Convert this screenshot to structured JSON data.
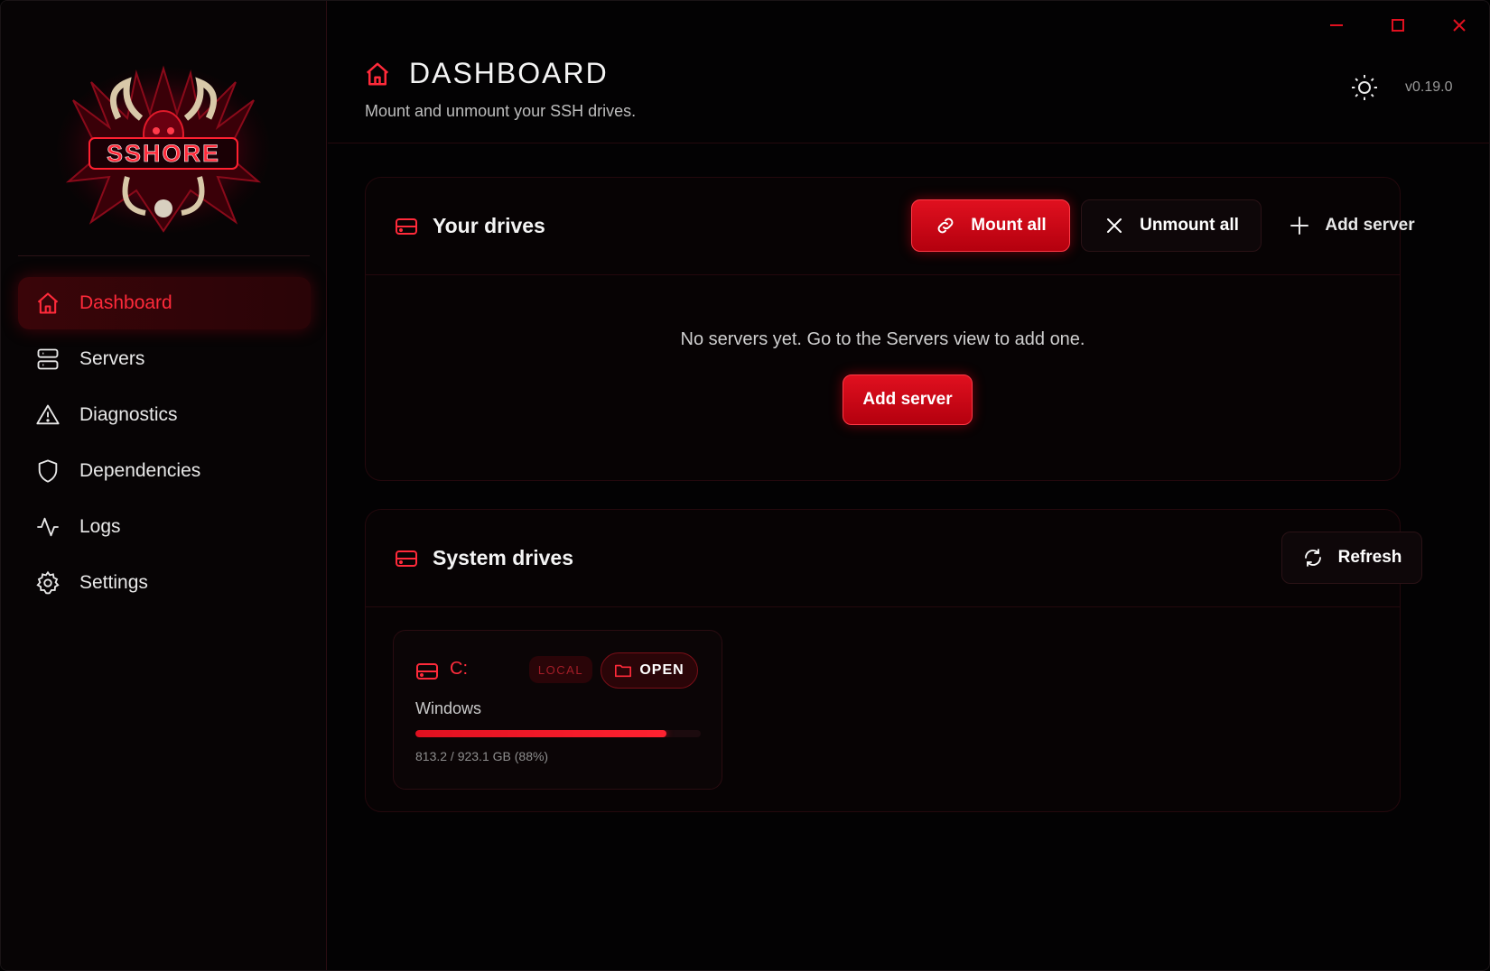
{
  "window": {
    "controls": [
      "minimize",
      "maximize",
      "close"
    ]
  },
  "sidebar": {
    "logo_text": "SSHORE",
    "items": [
      {
        "label": "Dashboard",
        "icon": "home-icon",
        "active": true
      },
      {
        "label": "Servers",
        "icon": "server-icon",
        "active": false
      },
      {
        "label": "Diagnostics",
        "icon": "warning-icon",
        "active": false
      },
      {
        "label": "Dependencies",
        "icon": "shield-icon",
        "active": false
      },
      {
        "label": "Logs",
        "icon": "activity-icon",
        "active": false
      },
      {
        "label": "Settings",
        "icon": "gear-icon",
        "active": false
      }
    ]
  },
  "header": {
    "title": "DASHBOARD",
    "subtitle": "Mount and unmount your SSH drives.",
    "version": "v0.19.0"
  },
  "your_drives": {
    "title": "Your drives",
    "mount_all_label": "Mount all",
    "unmount_all_label": "Unmount all",
    "add_server_label": "Add server",
    "empty_message": "No servers yet. Go to the Servers view to add one.",
    "empty_add_server_label": "Add server"
  },
  "system_drives": {
    "title": "System drives",
    "refresh_label": "Refresh",
    "drives": [
      {
        "letter": "C:",
        "badge": "LOCAL",
        "open_label": "OPEN",
        "name": "Windows",
        "usage_text": "813.2 / 923.1 GB (88%)",
        "usage_fraction": 0.88
      }
    ]
  },
  "colors": {
    "accent": "#e0101f",
    "accent_bright": "#ff2a3a",
    "background": "#030203"
  }
}
